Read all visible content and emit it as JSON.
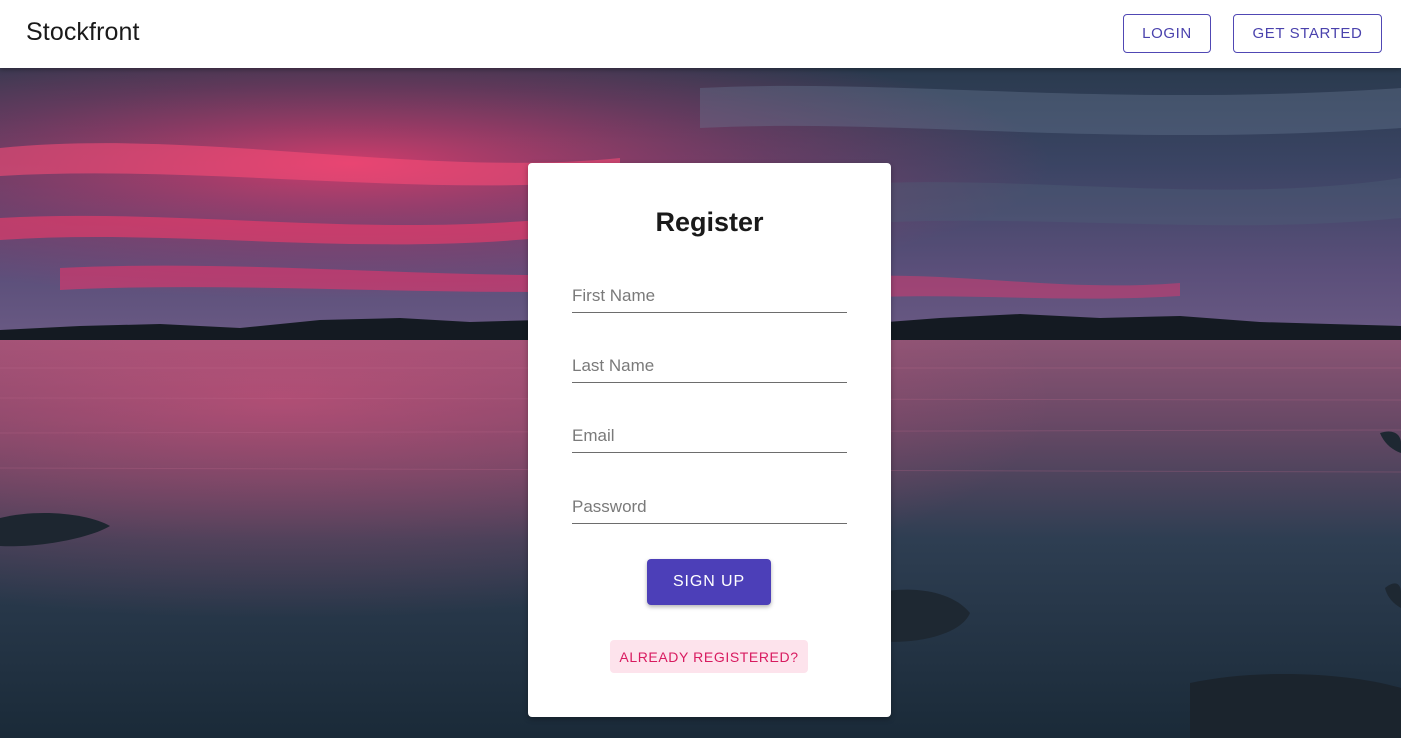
{
  "header": {
    "brand": "Stockfront",
    "login_label": "LOGIN",
    "get_started_label": "GET STARTED"
  },
  "register": {
    "title": "Register",
    "fields": {
      "first_name": {
        "placeholder": "First Name",
        "value": ""
      },
      "last_name": {
        "placeholder": "Last Name",
        "value": ""
      },
      "email": {
        "placeholder": "Email",
        "value": ""
      },
      "password": {
        "placeholder": "Password",
        "value": ""
      }
    },
    "signup_label": "SIGN UP",
    "already_registered_label": "ALREADY REGISTERED?"
  },
  "colors": {
    "primary": "#4c3fb8",
    "secondary": "#d81b60",
    "secondary_bg": "#fde3ec"
  }
}
